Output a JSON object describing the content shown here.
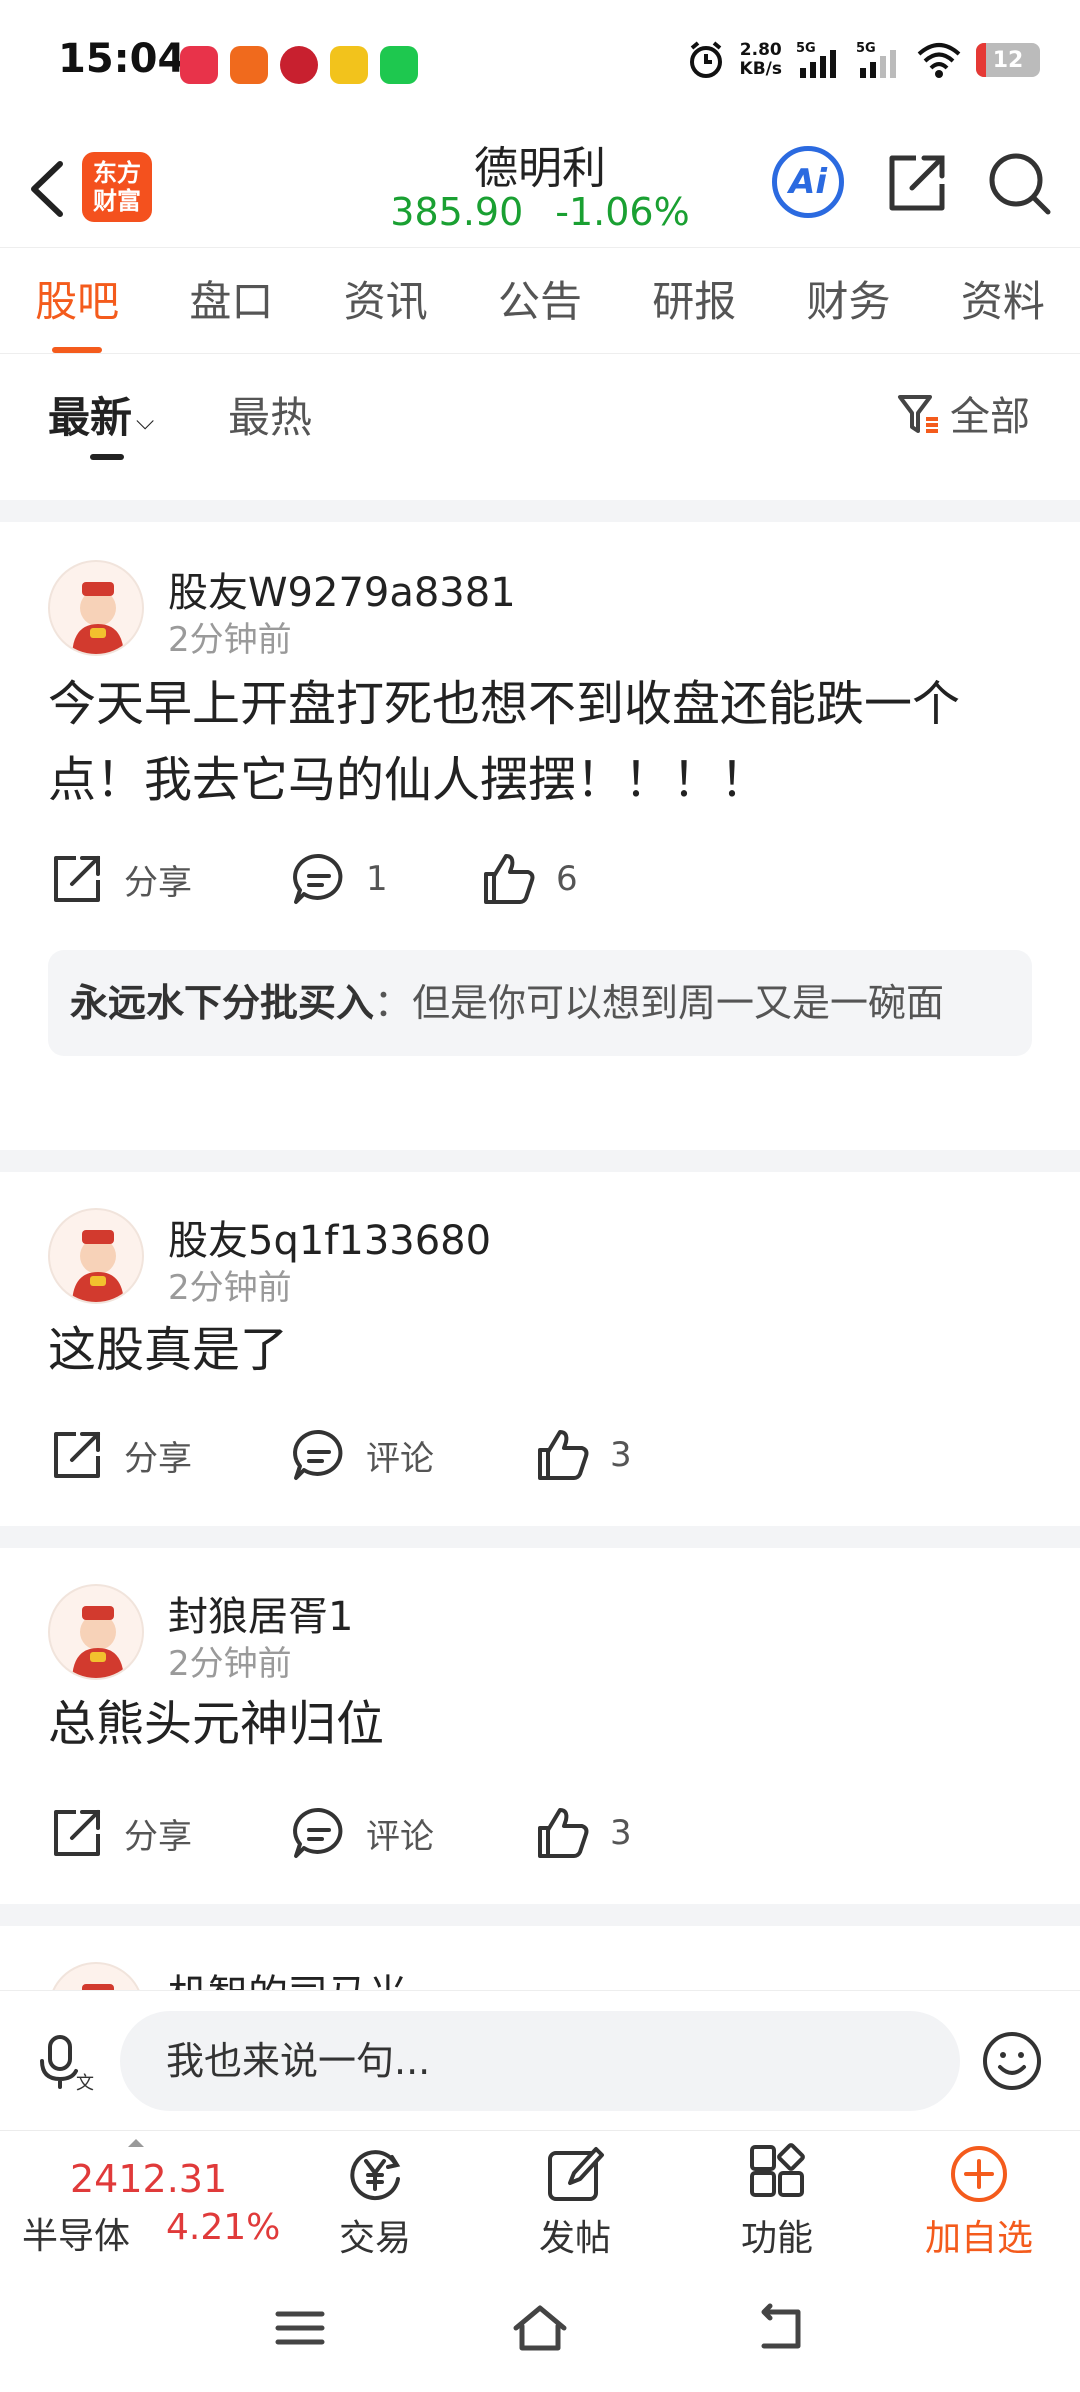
{
  "status_bar": {
    "time": "15:04",
    "speed_value": "2.80",
    "speed_unit": "KB/s",
    "battery": "12"
  },
  "header": {
    "logo_text": "东方财富",
    "stock_name": "德明利",
    "price": "385.90",
    "change_pct": "-1.06%",
    "ai_label": "Ai"
  },
  "tabs": [
    "股吧",
    "盘口",
    "资讯",
    "公告",
    "研报",
    "财务",
    "资料"
  ],
  "sort": {
    "latest": "最新",
    "hot": "最热",
    "filter": "全部"
  },
  "labels": {
    "share": "分享",
    "comment": "评论"
  },
  "posts": [
    {
      "author": "股友W9279a8381",
      "time": "2分钟前",
      "content": "今天早上开盘打死也想不到收盘还能跌一个点！我去它马的仙人摆摆！！！！",
      "comments": "1",
      "likes": "6",
      "reply_author": "永远水下分批买入",
      "reply_text": "：但是你可以想到周一又是一碗面"
    },
    {
      "author": "股友5q1f133680",
      "time": "2分钟前",
      "content": "这股真是了",
      "comments": "评论",
      "likes": "3"
    },
    {
      "author": "封狼居胥1",
      "time": "2分钟前",
      "content": "总熊头元神归位",
      "comments": "评论",
      "likes": "3"
    },
    {
      "author": "机智的司马光"
    }
  ],
  "comment_bar": {
    "placeholder": "我也来说一句..."
  },
  "bottom_bar": {
    "index_value": "2412.31",
    "index_name": "半导体",
    "index_change": "4.21%",
    "trade": "交易",
    "post": "发帖",
    "function": "功能",
    "add_watch": "加自选"
  },
  "colors": {
    "accent": "#f45b1c",
    "down_green": "#1aa032",
    "up_red": "#e03a3a",
    "ai_blue": "#2b6ae0"
  }
}
